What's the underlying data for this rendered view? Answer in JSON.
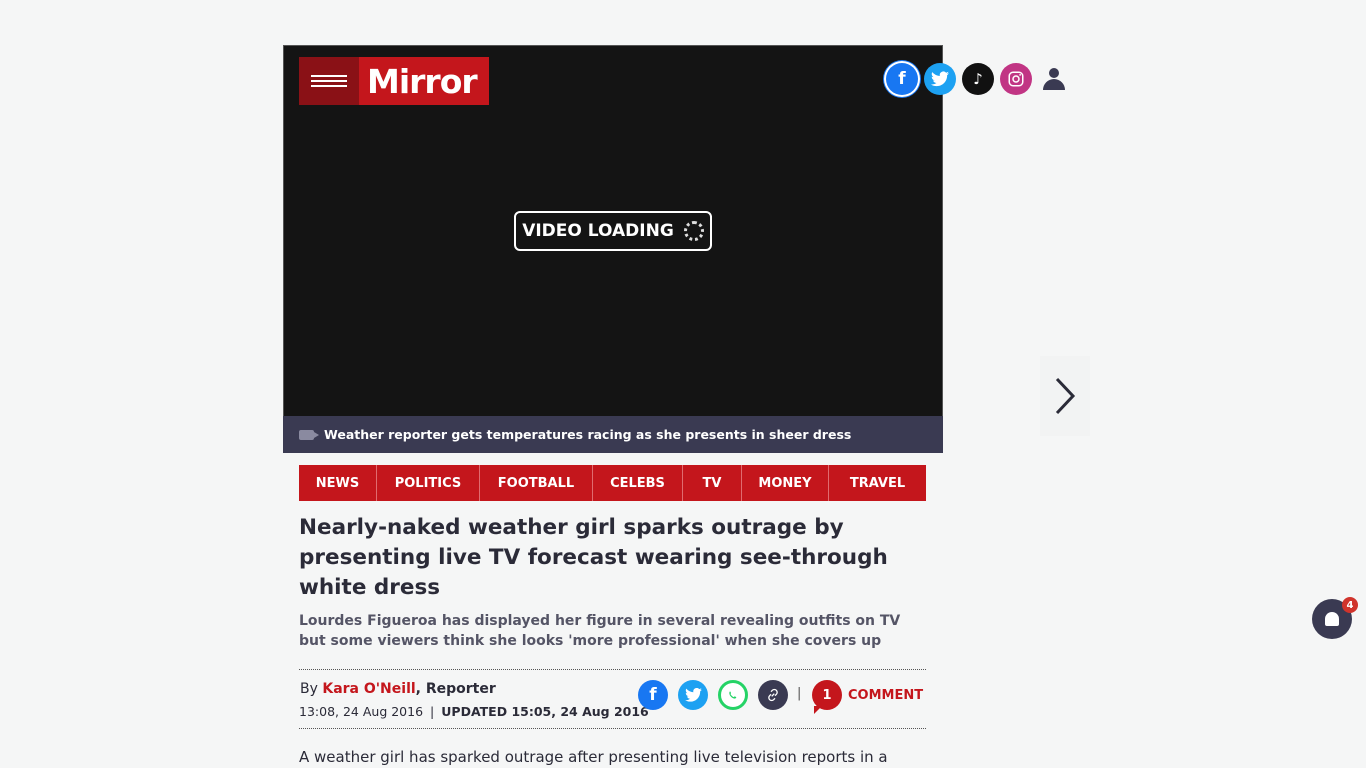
{
  "brand": {
    "name": "Mirror",
    "color": "#c4161c"
  },
  "video": {
    "loading_label": "VIDEO LOADING",
    "caption": "Weather reporter gets temperatures racing as she presents in sheer dress"
  },
  "social_top": [
    "facebook-icon",
    "twitter-icon",
    "tiktok-icon",
    "instagram-icon",
    "user-icon"
  ],
  "nav": {
    "items": [
      {
        "label": "NEWS"
      },
      {
        "label": "POLITICS"
      },
      {
        "label": "FOOTBALL"
      },
      {
        "label": "CELEBS"
      },
      {
        "label": "TV"
      },
      {
        "label": "MONEY"
      },
      {
        "label": "TRAVEL"
      }
    ]
  },
  "article": {
    "headline": "Nearly-naked weather girl sparks outrage by presenting live TV forecast wearing see-through white dress",
    "standfirst": "Lourdes Figueroa has displayed her figure in several revealing outfits on TV but some viewers think she looks 'more professional' when she covers up",
    "by_prefix": "By ",
    "author": "Kara O'Neill",
    "role": ", Reporter",
    "published": "13:08, 24 Aug 2016",
    "separator": "|",
    "updated": "UPDATED 15:05, 24 Aug 2016",
    "comment_count": "1",
    "comment_label": "COMMENT",
    "first_paragraph": "A weather girl has sparked outrage after presenting live television reports in a short,"
  },
  "notifications": {
    "count": "4"
  }
}
